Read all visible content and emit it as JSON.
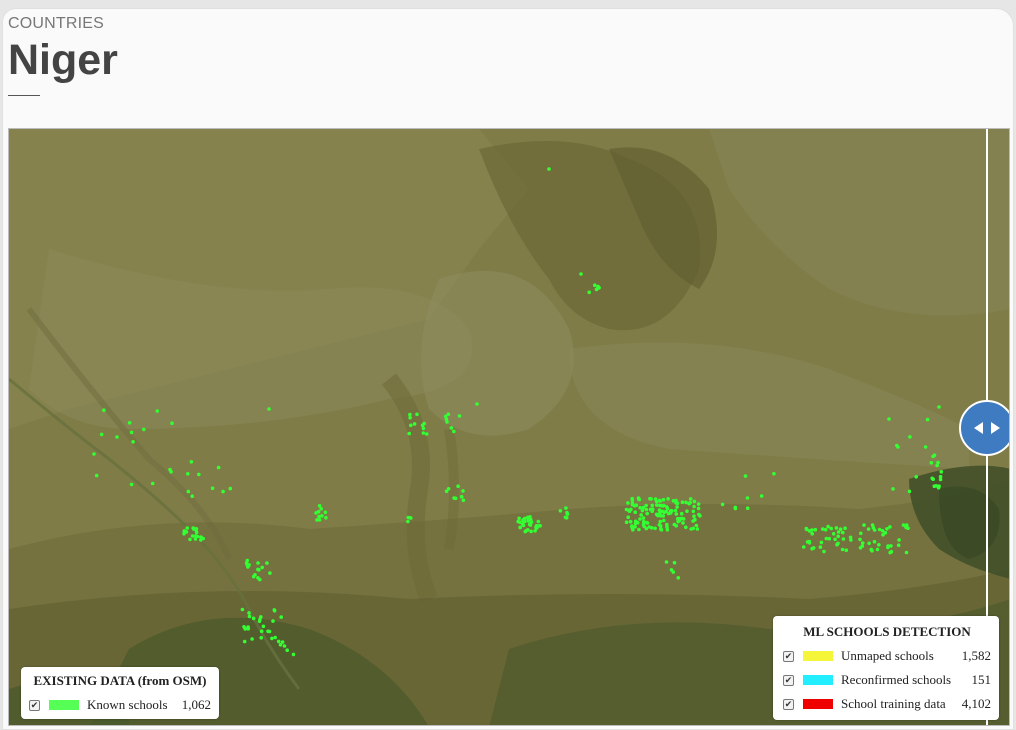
{
  "header": {
    "eyebrow": "COUNTRIES",
    "country": "Niger"
  },
  "map": {
    "base_color": "#7d7a45",
    "school_color": "#33ff33",
    "swipe_icon": "arrow-left-right-icon"
  },
  "legend_osm": {
    "title": "EXISTING DATA (from OSM)",
    "items": [
      {
        "label": "Known schools",
        "count": "1,062",
        "color": "#55ff55",
        "checked": true
      }
    ]
  },
  "legend_ml": {
    "title": "ML SCHOOLS DETECTION",
    "items": [
      {
        "label": "Unmaped schools",
        "count": "1,582",
        "color": "#f5f53a",
        "checked": true
      },
      {
        "label": "Reconfirmed schools",
        "count": "151",
        "color": "#22eeff",
        "checked": true
      },
      {
        "label": "School training data",
        "count": "4,102",
        "color": "#ee0000",
        "checked": true
      }
    ]
  }
}
